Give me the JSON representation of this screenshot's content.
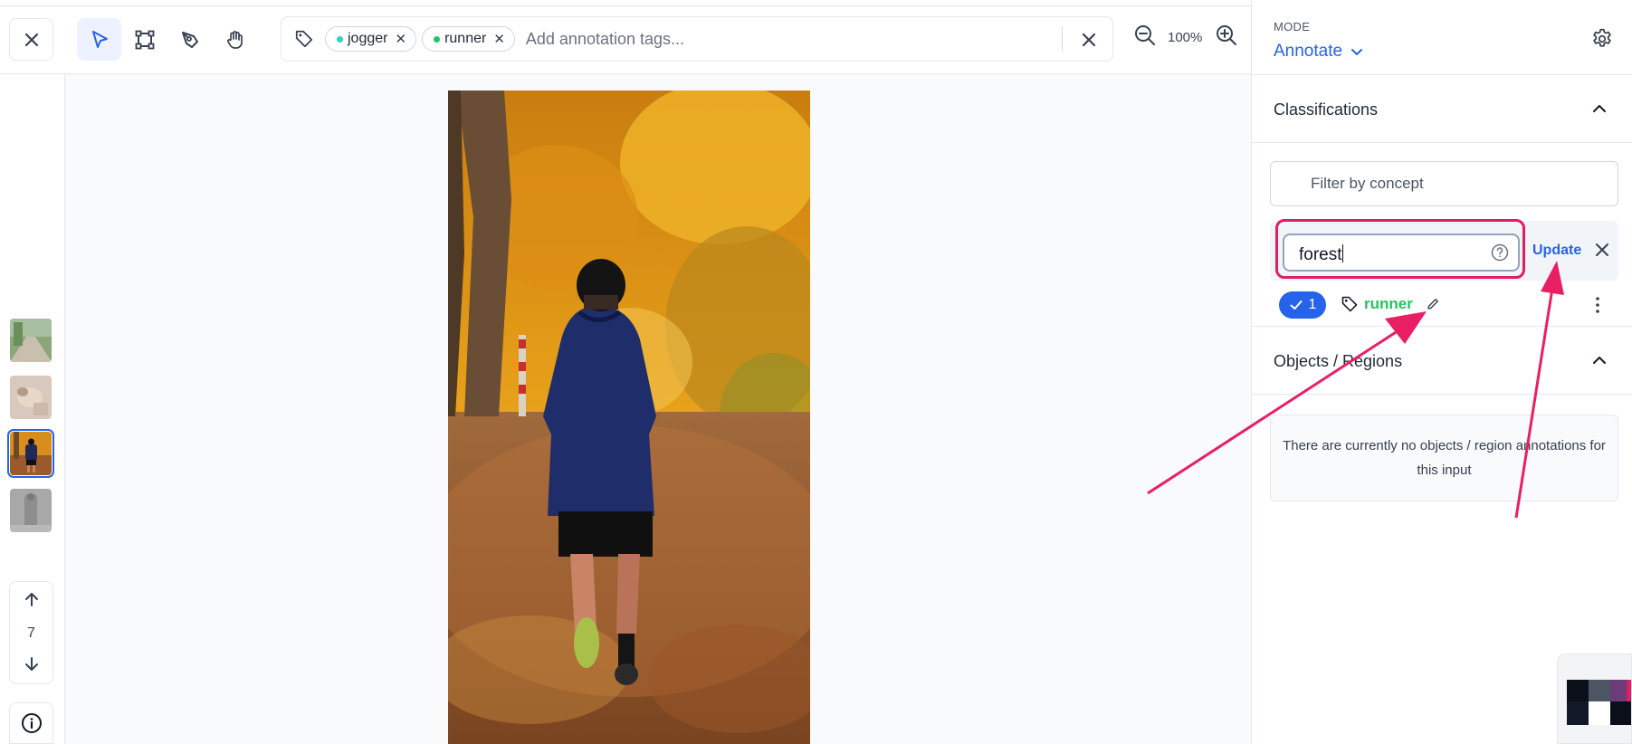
{
  "toolbar": {
    "tags": [
      {
        "label": "jogger",
        "color": "#2dd4bf"
      },
      {
        "label": "runner",
        "color": "#22c55e"
      }
    ],
    "tag_placeholder": "Add annotation tags...",
    "zoom": "100%"
  },
  "pager": {
    "current": "7"
  },
  "panel": {
    "mode_label": "MODE",
    "mode_value": "Annotate",
    "classifications_title": "Classifications",
    "filter_placeholder": "Filter by concept",
    "edit_value": "forest",
    "update_label": "Update",
    "label_count": "1",
    "label_name": "runner",
    "objects_title": "Objects / Regions",
    "empty_message": "There are currently no objects / region annotations for this input"
  },
  "colors": {
    "accent": "#2563eb",
    "highlight": "#e11d63",
    "label_green": "#22c55e"
  }
}
